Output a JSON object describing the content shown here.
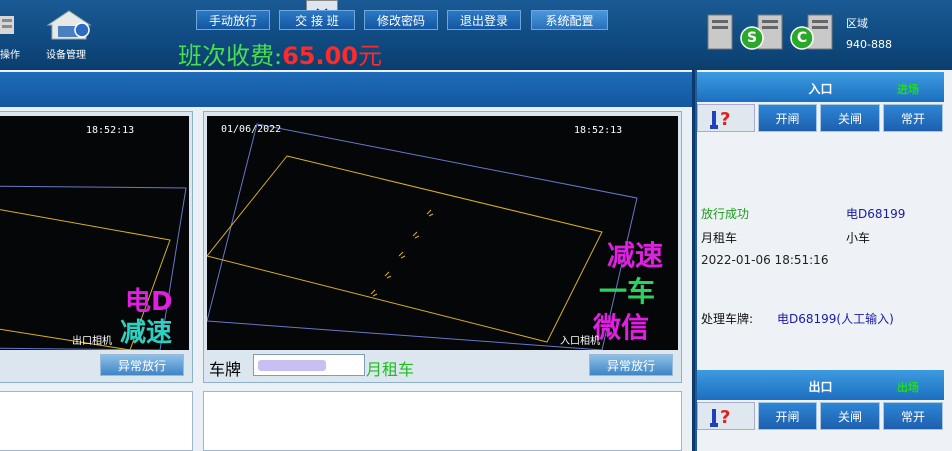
{
  "header": {
    "left_labels": [
      "操作",
      "设备管理"
    ],
    "buttons": [
      "手动放行",
      "交 接 班",
      "修改密码",
      "退出登录",
      "系统配置"
    ],
    "shift_fee": {
      "label": "班次收费:",
      "amount": "65.00",
      "unit": "元"
    },
    "server": {
      "region_label": "区域",
      "code": "940-888",
      "status_letters": [
        "S",
        "C"
      ]
    }
  },
  "cameras": {
    "left": {
      "time": "18:52:13",
      "name": "出口相机",
      "led_text": [
        "电D",
        "减速"
      ],
      "action_label": "异常放行"
    },
    "right": {
      "date": "01/06/2022",
      "time": "18:52:13",
      "name": "入口相机",
      "led_text": [
        "减速",
        "一车",
        "微信"
      ],
      "action_label": "异常放行"
    }
  },
  "plate_bar": {
    "label": "车牌",
    "plate_value": "",
    "car_type": "月租车"
  },
  "entrance": {
    "title": "入口",
    "status": "进场",
    "buttons": [
      "开闸",
      "关闸",
      "常开"
    ],
    "result": "放行成功",
    "plate": "电D68199",
    "vehicle_category": "月租车",
    "vehicle_size": "小车",
    "datetime": "2022-01-06 18:51:16",
    "processed_label": "处理车牌:",
    "processed_value": "电D68199(人工输入)"
  },
  "exit": {
    "title": "出口",
    "status": "出场",
    "buttons": [
      "开闸",
      "关闸",
      "常开"
    ]
  },
  "colors": {
    "status_green": "#1fdc1f",
    "fee_red": "#ff2a2a",
    "fee_green": "#47e04b",
    "plate_blue": "#1a1aa6",
    "car_type_green": "#22bb22"
  }
}
